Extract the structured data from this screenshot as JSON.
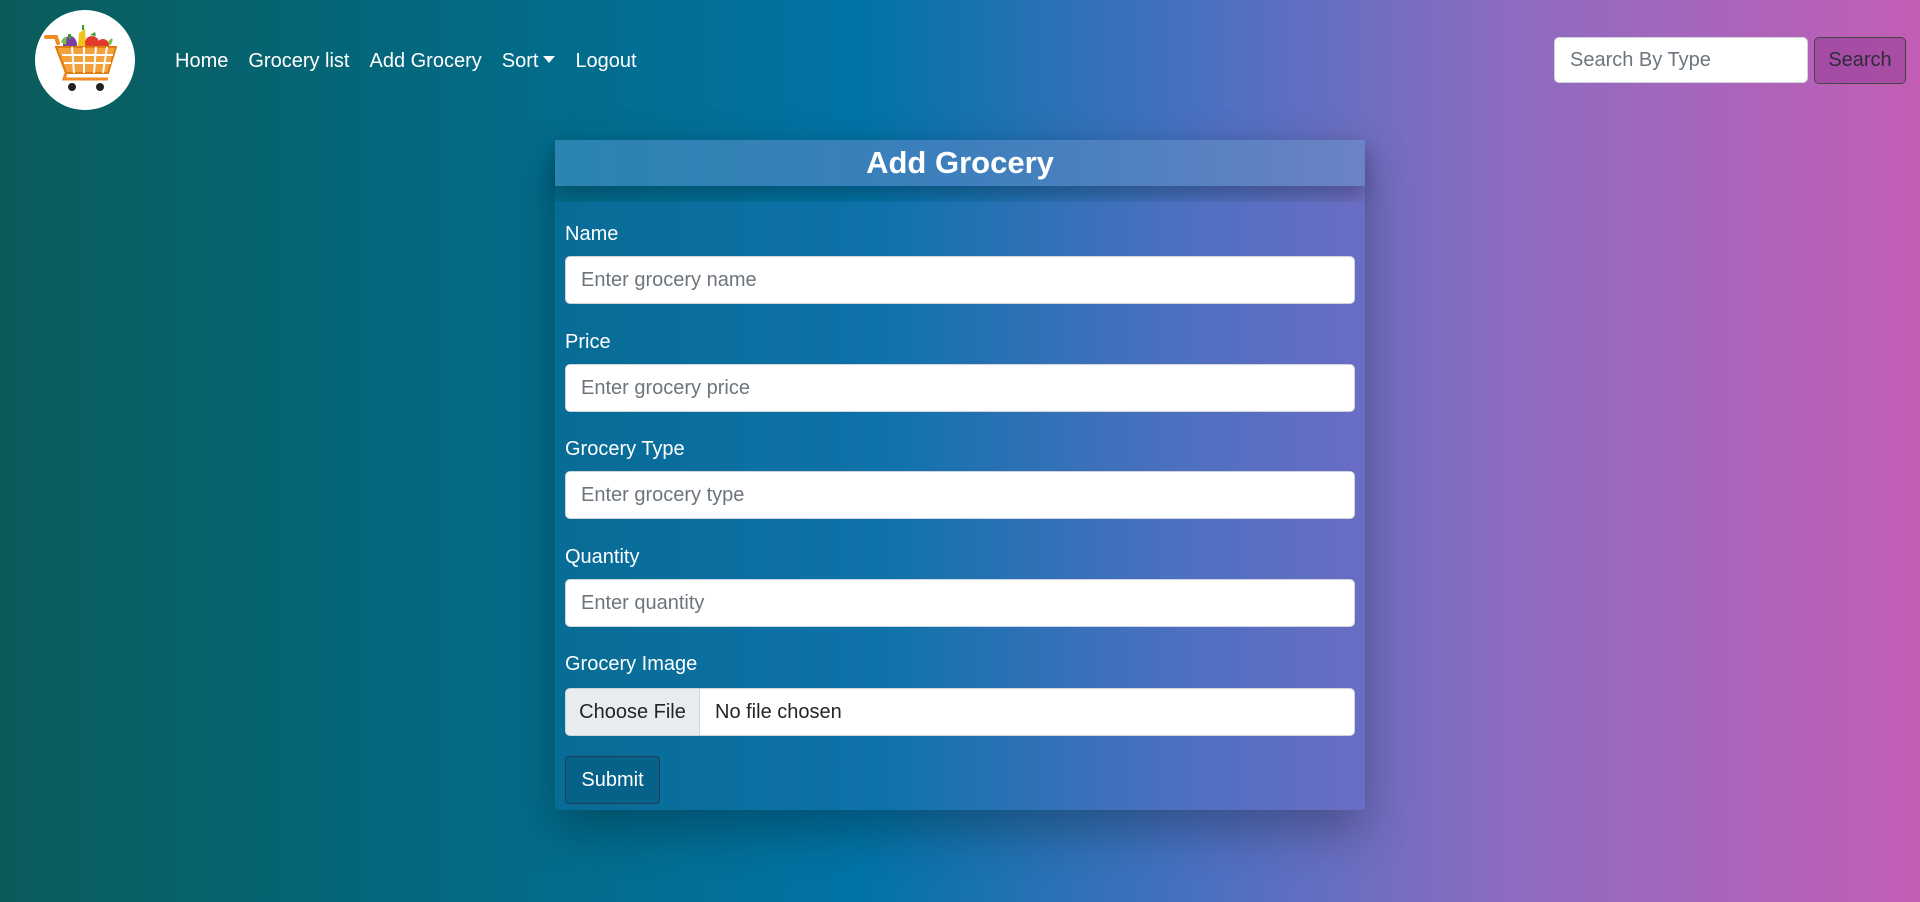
{
  "nav": {
    "logo_icon": "grocery-cart-icon",
    "links": [
      {
        "label": "Home"
      },
      {
        "label": "Grocery list"
      },
      {
        "label": "Add Grocery"
      },
      {
        "label": "Sort"
      },
      {
        "label": "Logout"
      }
    ],
    "search": {
      "placeholder": "Search By Type",
      "value": "",
      "button_label": "Search"
    }
  },
  "form": {
    "title": "Add Grocery",
    "fields": [
      {
        "label": "Name",
        "placeholder": "Enter grocery name",
        "value": ""
      },
      {
        "label": "Price",
        "placeholder": "Enter grocery price",
        "value": ""
      },
      {
        "label": "Grocery Type",
        "placeholder": "Enter grocery type",
        "value": ""
      },
      {
        "label": "Quantity",
        "placeholder": "Enter quantity",
        "value": ""
      }
    ],
    "image": {
      "label": "Grocery Image",
      "choose_label": "Choose File",
      "status": "No file chosen"
    },
    "submit_label": "Submit"
  },
  "colors": {
    "gradient_left": "#0a5c5a",
    "gradient_mid": "#0173a6",
    "gradient_right": "#c35eb4",
    "submit_bg": "#07628a"
  }
}
